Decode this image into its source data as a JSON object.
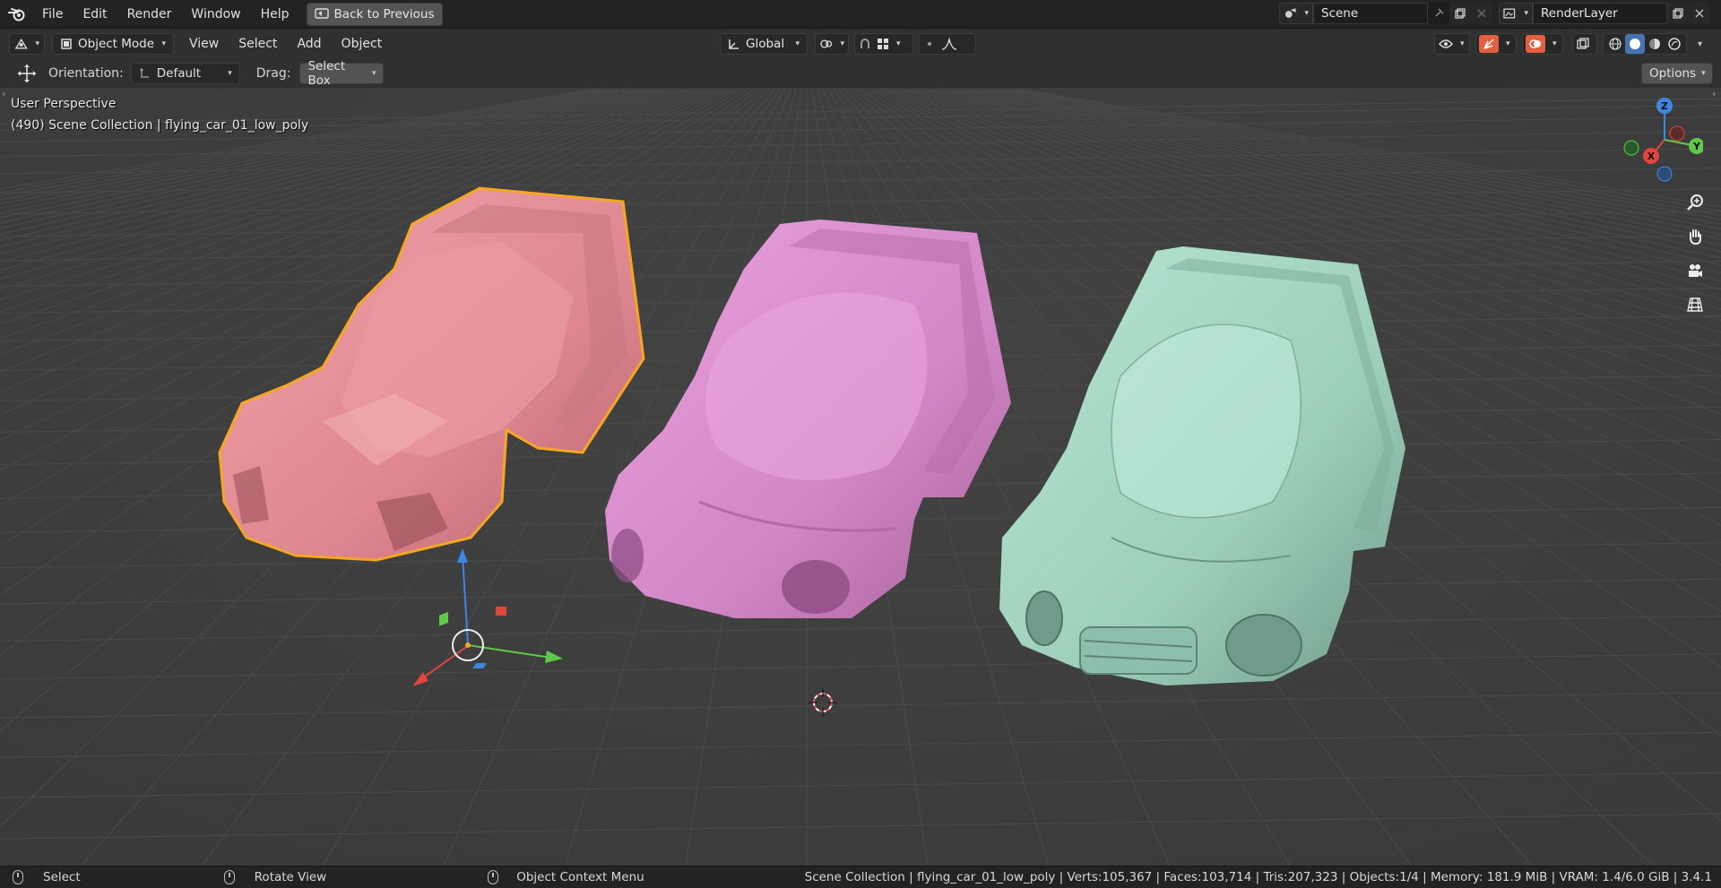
{
  "topbar": {
    "menu": [
      "File",
      "Edit",
      "Render",
      "Window",
      "Help"
    ],
    "back_button": "Back to Previous",
    "scene_name": "Scene",
    "render_layer": "RenderLayer"
  },
  "header": {
    "mode": "Object Mode",
    "menus": [
      "View",
      "Select",
      "Add",
      "Object"
    ],
    "transform_orientation": "Global"
  },
  "tool_settings": {
    "orientation_label": "Orientation:",
    "orientation_value": "Default",
    "drag_label": "Drag:",
    "drag_value": "Select Box",
    "options_label": "Options"
  },
  "viewport": {
    "perspective": "User Perspective",
    "collection_info": "(490) Scene Collection | flying_car_01_low_poly",
    "gizmo_axes": {
      "z": "Z",
      "y": "Y",
      "x": "X"
    },
    "colors": {
      "background": "#3d3d3d",
      "car_low": "#e8919a",
      "car_mid": "#db8ed0",
      "car_high": "#9fd6c0",
      "selection": "#f5a623",
      "axis_x": "#e0463c",
      "axis_y": "#5fc848",
      "axis_z": "#3f86e0"
    }
  },
  "statusbar": {
    "select": "Select",
    "rotate": "Rotate View",
    "context_menu": "Object Context Menu",
    "stats": "Scene Collection | flying_car_01_low_poly | Verts:105,367 | Faces:103,714 | Tris:207,323 | Objects:1/4 | Memory: 181.9 MiB | VRAM: 1.4/6.0 GiB | 3.4.1"
  }
}
